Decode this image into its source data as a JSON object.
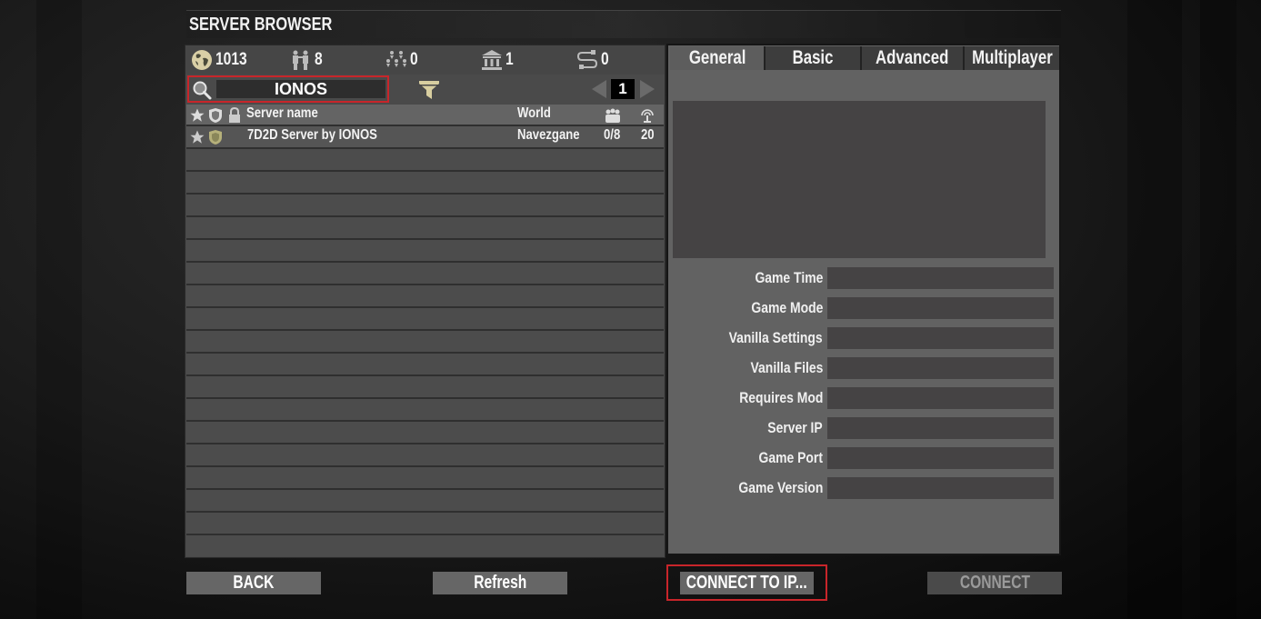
{
  "title": "SERVER BROWSER",
  "stats": {
    "servers_total": "1013",
    "friends": "8",
    "players": "0",
    "lan": "1",
    "history": "0"
  },
  "search": {
    "value": "IONOS",
    "placeholder": ""
  },
  "pager": {
    "current_page": "1"
  },
  "list": {
    "columns": {
      "name": "Server name",
      "world": "World"
    },
    "rows": [
      {
        "name": "7D2D Server by IONOS",
        "world": "Navezgane",
        "players": "0/8",
        "ping": "20"
      }
    ],
    "empty_row_count": 18
  },
  "details": {
    "tabs": [
      "General",
      "Basic",
      "Advanced",
      "Multiplayer"
    ],
    "active_tab": "General",
    "fields": [
      {
        "label": "Game Time",
        "value": ""
      },
      {
        "label": "Game Mode",
        "value": ""
      },
      {
        "label": "Vanilla Settings",
        "value": ""
      },
      {
        "label": "Vanilla Files",
        "value": ""
      },
      {
        "label": "Requires Mod",
        "value": ""
      },
      {
        "label": "Server IP",
        "value": ""
      },
      {
        "label": "Game Port",
        "value": ""
      },
      {
        "label": "Game Version",
        "value": ""
      }
    ]
  },
  "buttons": {
    "back": "BACK",
    "refresh": "Refresh",
    "connect_to_ip": "CONNECT TO IP...",
    "connect": "CONNECT"
  },
  "colors": {
    "highlight": "#c8252a",
    "favorite_shield": "#b5b07a",
    "filter": "#d8ceA0"
  }
}
